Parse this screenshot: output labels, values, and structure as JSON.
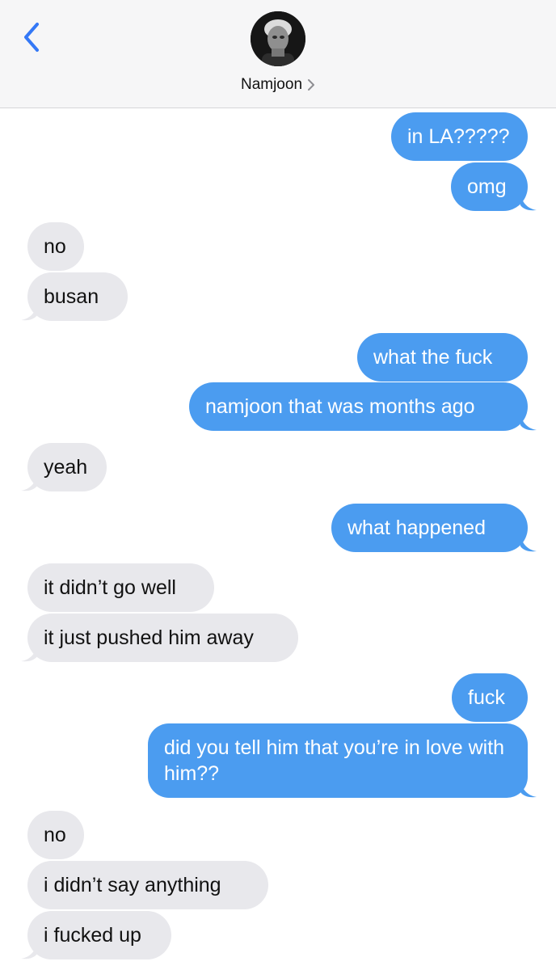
{
  "header": {
    "contact_name": "Namjoon",
    "back_icon": "chevron-left-icon",
    "disclosure_icon": "chevron-right-icon",
    "accent_color": "#3478f6"
  },
  "colors": {
    "sent_bubble": "#4b9cf0",
    "received_bubble": "#e8e8ec"
  },
  "messages": [
    {
      "direction": "sent",
      "text": "in LA?????"
    },
    {
      "direction": "sent",
      "text": "omg"
    },
    {
      "direction": "received",
      "text": "no"
    },
    {
      "direction": "received",
      "text": "busan"
    },
    {
      "direction": "sent",
      "text": "what the fuck"
    },
    {
      "direction": "sent",
      "text": "namjoon that was months ago"
    },
    {
      "direction": "received",
      "text": "yeah"
    },
    {
      "direction": "sent",
      "text": "what happened"
    },
    {
      "direction": "received",
      "text": "it didn’t go well"
    },
    {
      "direction": "received",
      "text": "it just pushed him away"
    },
    {
      "direction": "sent",
      "text": "fuck"
    },
    {
      "direction": "sent",
      "text": "did you tell him that you’re in love with him??"
    },
    {
      "direction": "received",
      "text": "no"
    },
    {
      "direction": "received",
      "text": "i didn’t say anything"
    },
    {
      "direction": "received",
      "text": "i fucked up"
    }
  ]
}
